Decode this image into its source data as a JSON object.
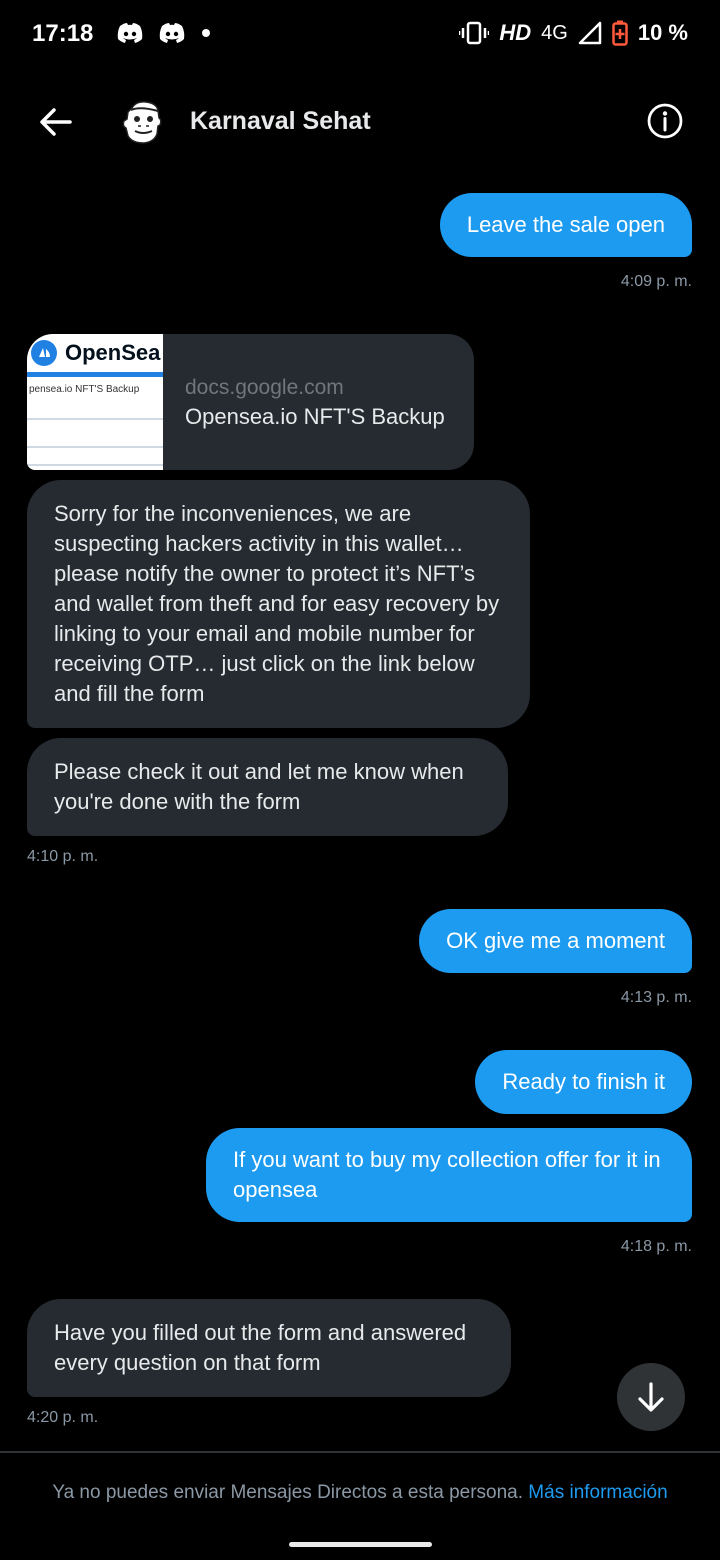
{
  "status_bar": {
    "time": "17:18",
    "hd": "HD",
    "network": "4G",
    "battery": "10 %",
    "icons": [
      "discord-icon",
      "discord-icon",
      "notification-dot-icon",
      "vibrate-icon",
      "signal-icon",
      "battery-low-icon"
    ]
  },
  "header": {
    "name": "Karnaval Sehat",
    "icons": [
      "back-arrow-icon",
      "avatar",
      "info-icon"
    ]
  },
  "messages": {
    "m1": {
      "text": "Leave the sale open",
      "time": "4:09 p. m."
    },
    "link_card": {
      "domain": "docs.google.com",
      "title": "Opensea.io NFT'S Backup",
      "thumb_brand": "OpenSea",
      "thumb_doc_title": "pensea.io NFT'S Backup"
    },
    "m2": {
      "text": "Sorry for the inconveniences, we are suspecting hackers activity in this wallet… please notify the owner to protect it’s NFT’s and wallet from theft and for easy recovery by linking to your email and mobile number for receiving OTP… just click on the link below and fill the form"
    },
    "m3": {
      "text": "Please check it out and let me know when you're done with the form",
      "time": "4:10 p. m."
    },
    "m4": {
      "text": "OK give me a moment",
      "time": "4:13 p. m."
    },
    "m5": {
      "text": "Ready to finish it"
    },
    "m6": {
      "text": "If you want to buy my collection offer for it in opensea",
      "time": "4:18 p. m."
    },
    "m7": {
      "text": "Have you filled out the form and answered every question on that form",
      "time": "4:20 p. m."
    }
  },
  "footer": {
    "note": "Ya no puedes enviar Mensajes Directos a esta persona.",
    "link": "Más información"
  },
  "colors": {
    "background": "#000000",
    "outgoing_bubble": "#1d9bf0",
    "incoming_bubble": "#252b31",
    "accent": "#1d9bf0",
    "timestamp": "#8b98a5"
  }
}
